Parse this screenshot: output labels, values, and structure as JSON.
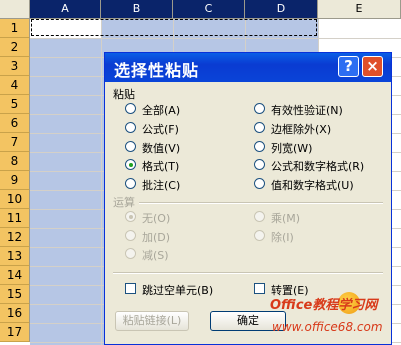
{
  "sheet": {
    "columns": [
      "A",
      "B",
      "C",
      "D",
      "E"
    ],
    "rows": [
      "1",
      "2",
      "3",
      "4",
      "5",
      "6",
      "7",
      "8",
      "9",
      "10",
      "11",
      "12",
      "13",
      "14",
      "15",
      "16",
      "17"
    ]
  },
  "dialog": {
    "title": "选择性粘贴",
    "help_button": "?",
    "close_button": "×",
    "paste_section_label": "粘贴",
    "paste_options_left": [
      "全部(A)",
      "公式(F)",
      "数值(V)",
      "格式(T)",
      "批注(C)"
    ],
    "paste_options_right": [
      "有效性验证(N)",
      "边框除外(X)",
      "列宽(W)",
      "公式和数字格式(R)",
      "值和数字格式(U)"
    ],
    "selected_paste_option": "格式(T)",
    "operation_section_label": "运算",
    "operation_options_left": [
      "无(O)",
      "加(D)",
      "减(S)"
    ],
    "operation_options_right": [
      "乘(M)",
      "除(I)"
    ],
    "skip_blanks_label": "跳过空单元(B)",
    "transpose_label": "转置(E)",
    "paste_link_button": "粘贴链接(L)",
    "ok_button": "确定"
  },
  "watermark": {
    "line1": "Office教程学习网",
    "line2": "www.office68.com"
  },
  "colors": {
    "selection_fill": "#b6c6e5",
    "row_header": "#f3c462",
    "selected_col_header": "#0a246a",
    "titlebar": "#0a44d8",
    "dialog_bg": "#ece9d8"
  }
}
